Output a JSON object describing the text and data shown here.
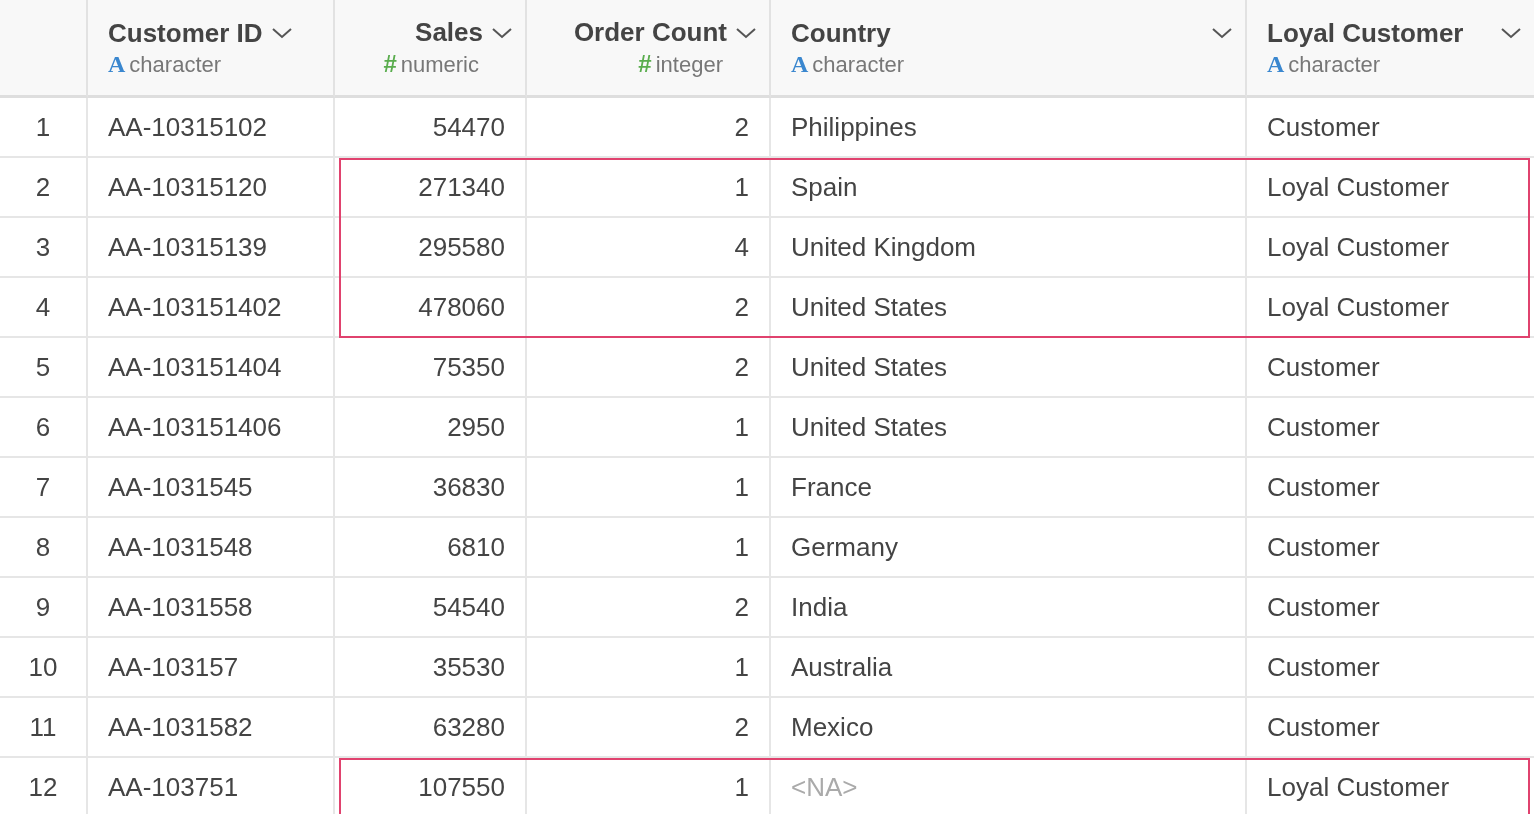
{
  "table": {
    "columns": [
      {
        "name": "Customer ID",
        "kind": "character",
        "type_icon": "A",
        "type_label": "character"
      },
      {
        "name": "Sales",
        "kind": "numeric",
        "type_icon": "#",
        "type_label": "numeric"
      },
      {
        "name": "Order Count",
        "kind": "numeric",
        "type_icon": "#",
        "type_label": "integer"
      },
      {
        "name": "Country",
        "kind": "character",
        "type_icon": "A",
        "type_label": "character"
      },
      {
        "name": "Loyal Customer",
        "kind": "character",
        "type_icon": "A",
        "type_label": "character"
      }
    ],
    "rows": [
      {
        "number": "1",
        "cells": [
          "AA-10315102",
          "54470",
          "2",
          "Philippines",
          "Customer"
        ],
        "highlighted": false
      },
      {
        "number": "2",
        "cells": [
          "AA-10315120",
          "271340",
          "1",
          "Spain",
          "Loyal Customer"
        ],
        "highlighted": true
      },
      {
        "number": "3",
        "cells": [
          "AA-10315139",
          "295580",
          "4",
          "United Kingdom",
          "Loyal Customer"
        ],
        "highlighted": true
      },
      {
        "number": "4",
        "cells": [
          "AA-103151402",
          "478060",
          "2",
          "United States",
          "Loyal Customer"
        ],
        "highlighted": true
      },
      {
        "number": "5",
        "cells": [
          "AA-103151404",
          "75350",
          "2",
          "United States",
          "Customer"
        ],
        "highlighted": false
      },
      {
        "number": "6",
        "cells": [
          "AA-103151406",
          "2950",
          "1",
          "United States",
          "Customer"
        ],
        "highlighted": false
      },
      {
        "number": "7",
        "cells": [
          "AA-1031545",
          "36830",
          "1",
          "France",
          "Customer"
        ],
        "highlighted": false
      },
      {
        "number": "8",
        "cells": [
          "AA-1031548",
          "6810",
          "1",
          "Germany",
          "Customer"
        ],
        "highlighted": false
      },
      {
        "number": "9",
        "cells": [
          "AA-1031558",
          "54540",
          "2",
          "India",
          "Customer"
        ],
        "highlighted": false
      },
      {
        "number": "10",
        "cells": [
          "AA-103157",
          "35530",
          "1",
          "Australia",
          "Customer"
        ],
        "highlighted": false
      },
      {
        "number": "11",
        "cells": [
          "AA-1031582",
          "63280",
          "2",
          "Mexico",
          "Customer"
        ],
        "highlighted": false
      },
      {
        "number": "12",
        "cells": [
          "AA-103751",
          "107550",
          "1",
          null,
          "Loyal Customer"
        ],
        "highlighted": true
      }
    ],
    "missing_label": "<NA>"
  }
}
